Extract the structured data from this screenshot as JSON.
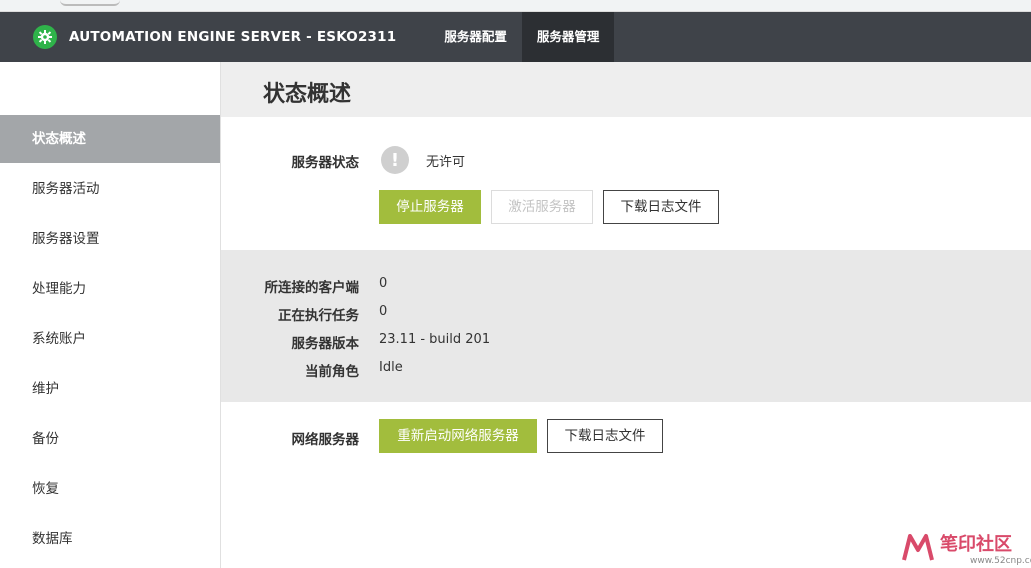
{
  "header": {
    "app_title": "AUTOMATION ENGINE SERVER - ESKO2311",
    "tabs": [
      {
        "label": "服务器配置",
        "active": false
      },
      {
        "label": "服务器管理",
        "active": true
      }
    ]
  },
  "sidebar": {
    "items": [
      {
        "label": "状态概述",
        "active": true
      },
      {
        "label": "服务器活动"
      },
      {
        "label": "服务器设置"
      },
      {
        "label": "处理能力"
      },
      {
        "label": "系统账户"
      },
      {
        "label": "维护"
      },
      {
        "label": "备份"
      },
      {
        "label": "恢复"
      },
      {
        "label": "数据库"
      }
    ]
  },
  "main": {
    "page_title": "状态概述",
    "server_status": {
      "label": "服务器状态",
      "value": "无许可",
      "icon": "warning-exclamation-icon",
      "buttons": {
        "stop": "停止服务器",
        "activate": "激活服务器",
        "download_log": "下载日志文件"
      }
    },
    "info": [
      {
        "label": "所连接的客户端",
        "value": "0"
      },
      {
        "label": "正在执行任务",
        "value": "0"
      },
      {
        "label": "服务器版本",
        "value": "23.11 - build 201"
      },
      {
        "label": "当前角色",
        "value": "Idle"
      }
    ],
    "web_server": {
      "label": "网络服务器",
      "buttons": {
        "restart": "重新启动网络服务器",
        "download_log": "下载日志文件"
      }
    }
  },
  "watermark": {
    "text": "笔印社区",
    "url": "www.52cnp.com"
  },
  "colors": {
    "topbar": "#3f4349",
    "active_tab": "#2c2f33",
    "accent_green": "#a2bd3d",
    "logo_green": "#2fb34a",
    "sidebar_active": "#a3a6a9"
  }
}
